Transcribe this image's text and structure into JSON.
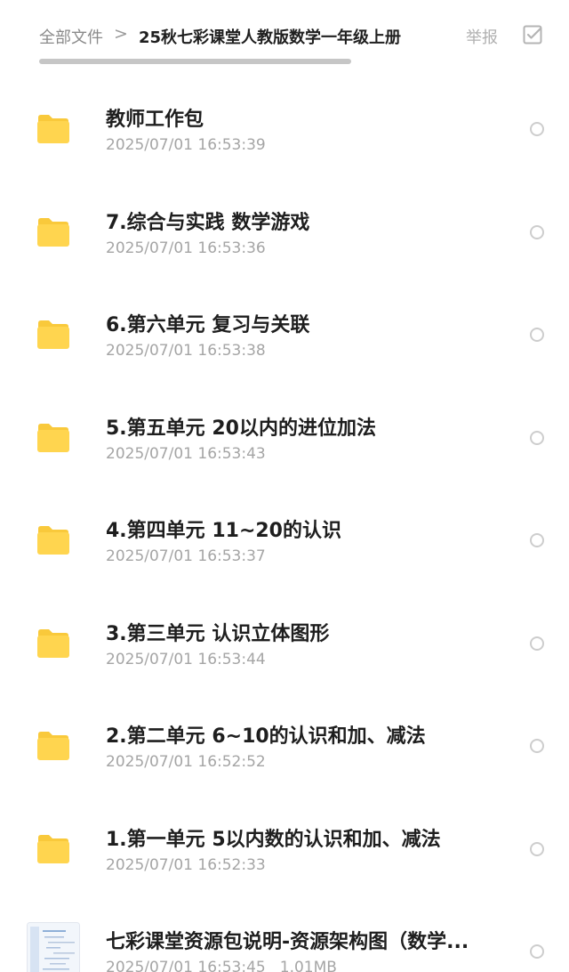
{
  "header": {
    "breadcrumb_root": "全部文件",
    "breadcrumb_separator": ">",
    "breadcrumb_current": "25秋七彩课堂人教版数学一年级上册",
    "report_label": "举报",
    "select_icon": "checkbox-icon"
  },
  "colors": {
    "folder": "#FFD54F",
    "folder_tab": "#F9C93B",
    "radio_border": "#CDCDCD",
    "title_text": "#1E1E1E",
    "meta_text": "#A5A5A5"
  },
  "items": [
    {
      "type": "folder",
      "icon": "folder-icon",
      "name": "教师工作包",
      "date": "2025/07/01 16:53:39"
    },
    {
      "type": "folder",
      "icon": "folder-icon",
      "name": "7.综合与实践 数学游戏",
      "date": "2025/07/01 16:53:36"
    },
    {
      "type": "folder",
      "icon": "folder-icon",
      "name": "6.第六单元 复习与关联",
      "date": "2025/07/01 16:53:38"
    },
    {
      "type": "folder",
      "icon": "folder-icon",
      "name": "5.第五单元 20以内的进位加法",
      "date": "2025/07/01 16:53:43"
    },
    {
      "type": "folder",
      "icon": "folder-icon",
      "name": "4.第四单元 11~20的认识",
      "date": "2025/07/01 16:53:37"
    },
    {
      "type": "folder",
      "icon": "folder-icon",
      "name": "3.第三单元 认识立体图形",
      "date": "2025/07/01 16:53:44"
    },
    {
      "type": "folder",
      "icon": "folder-icon",
      "name": "2.第二单元 6~10的认识和加、减法",
      "date": "2025/07/01 16:52:52"
    },
    {
      "type": "folder",
      "icon": "folder-icon",
      "name": "1.第一单元 5以内数的认识和加、减法",
      "date": "2025/07/01 16:52:33"
    },
    {
      "type": "file",
      "icon": "document-thumbnail-icon",
      "name": "七彩课堂资源包说明-资源架构图（数学...",
      "date": "2025/07/01 16:53:45",
      "size": "1.01MB"
    }
  ]
}
